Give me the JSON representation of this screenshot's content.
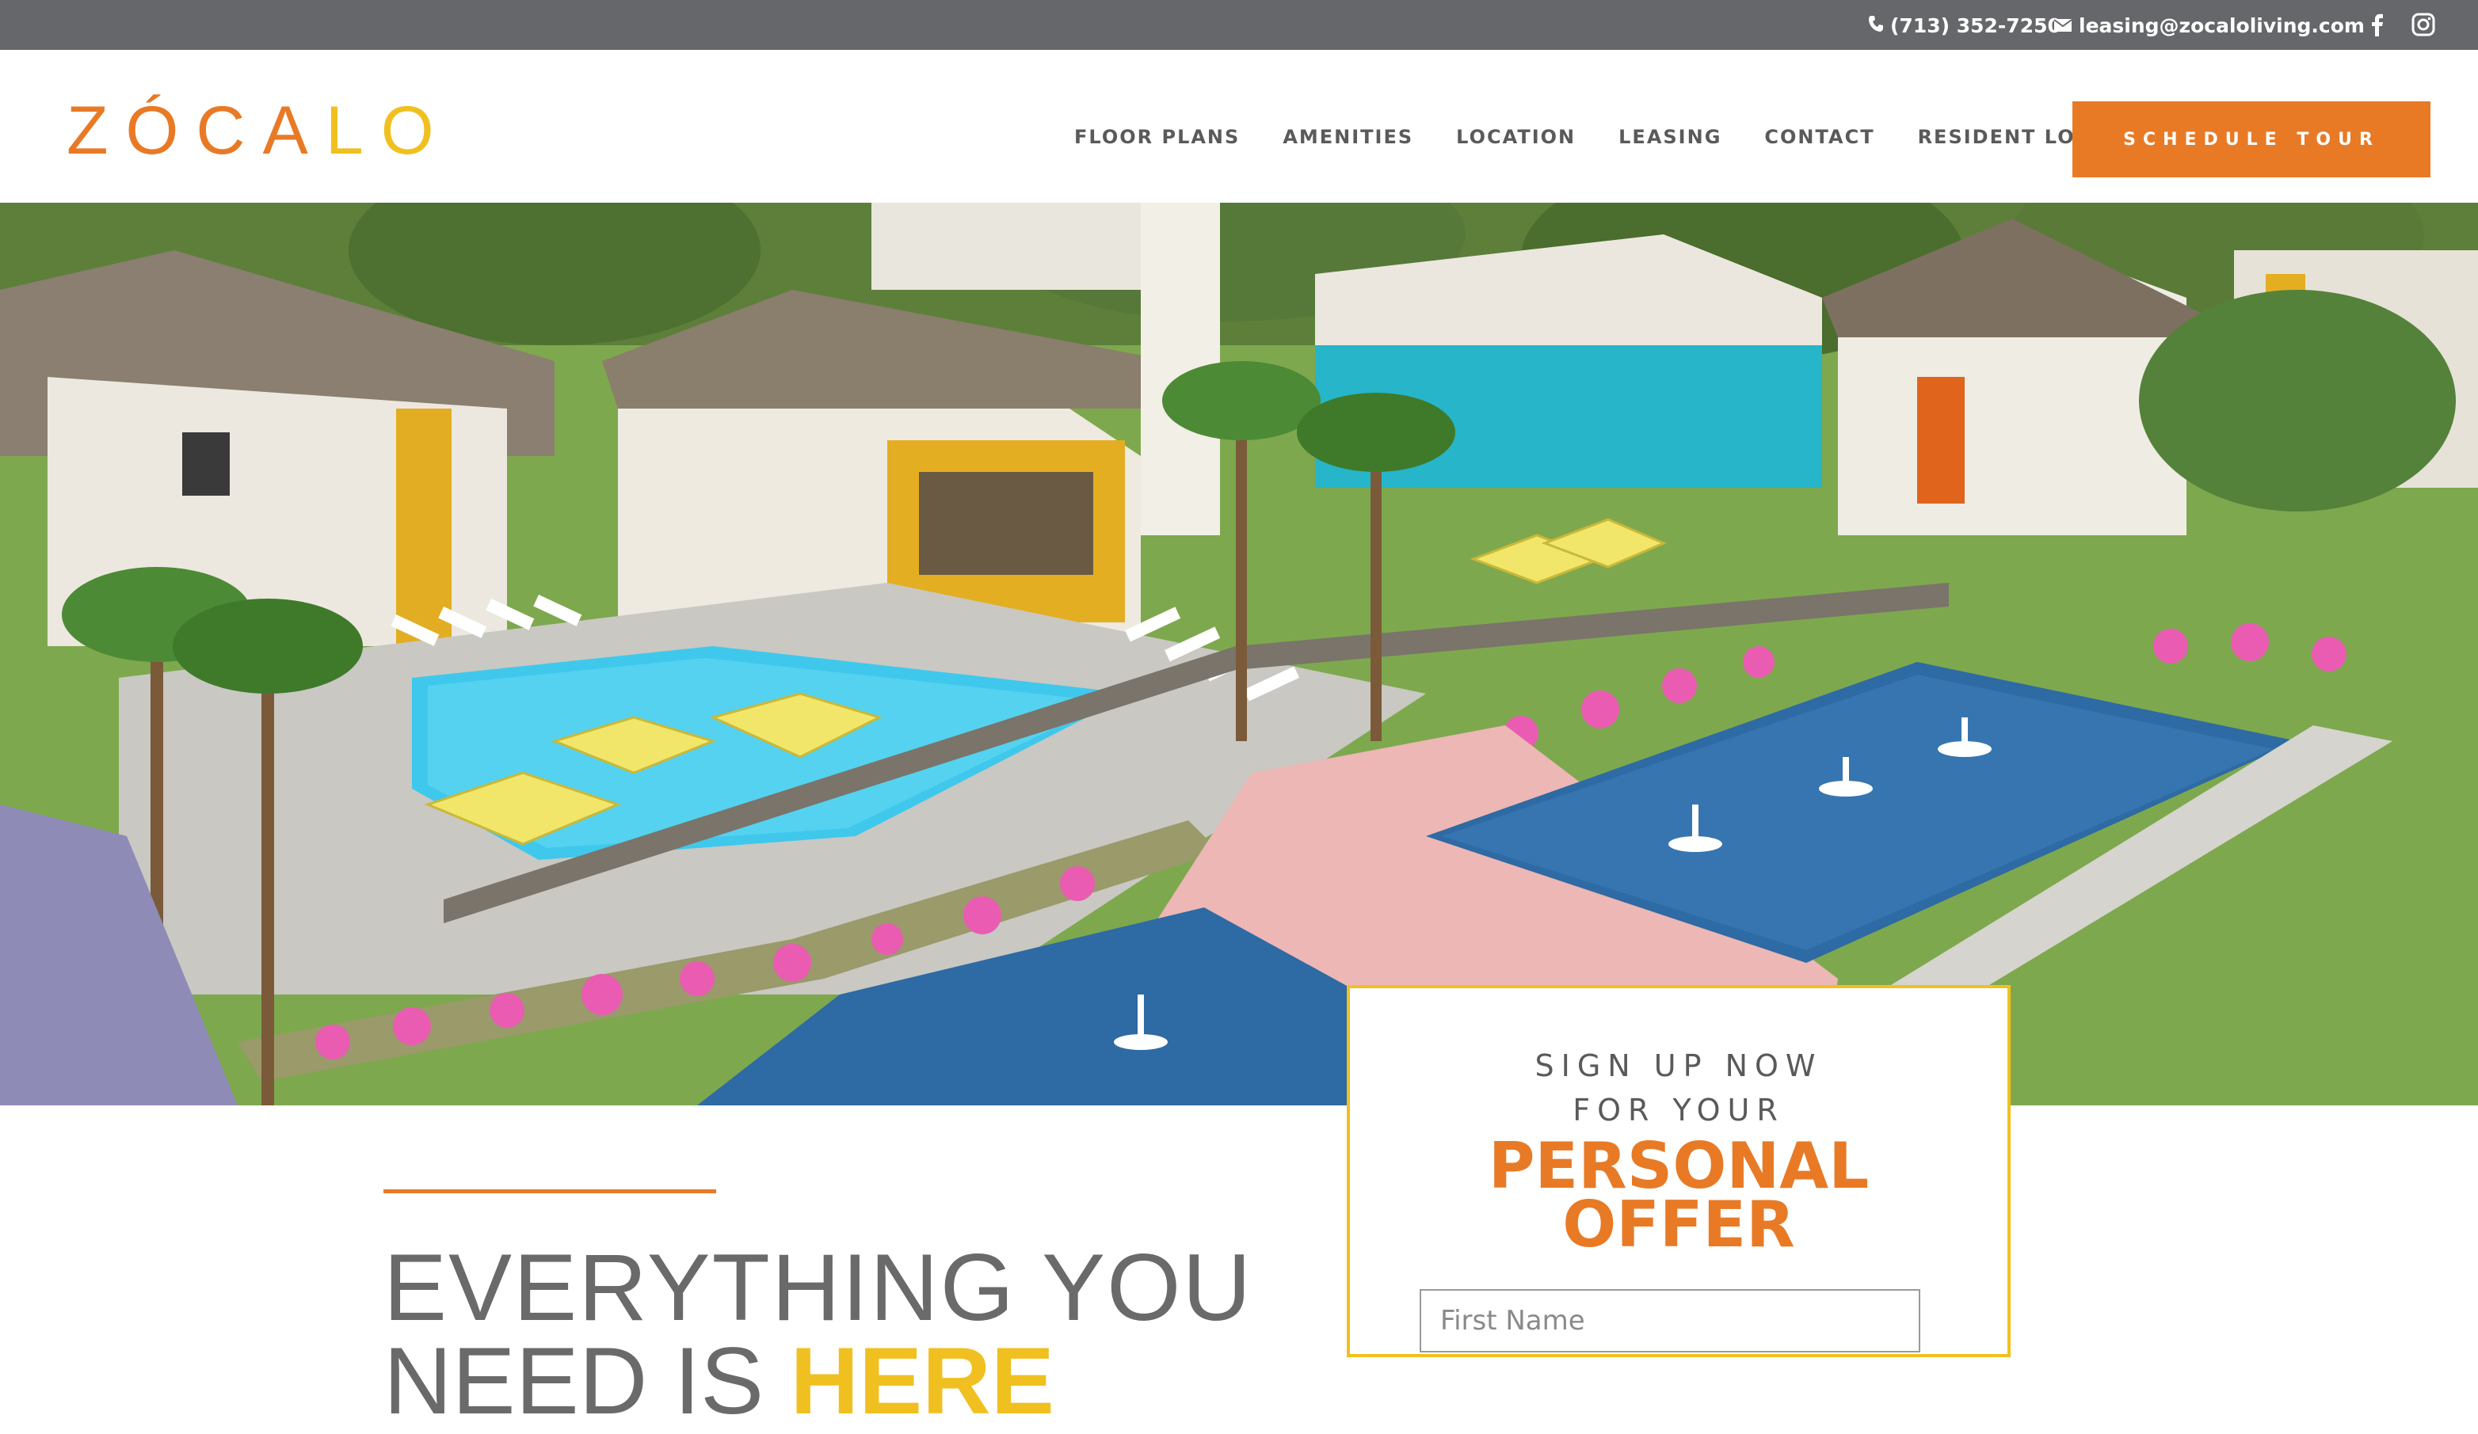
{
  "topbar": {
    "phone": "(713) 352-7250",
    "email": "leasing@zocaloliving.com",
    "icons": [
      "phone-icon",
      "mail-icon",
      "facebook-icon",
      "instagram-icon"
    ]
  },
  "header": {
    "logo": "ZÓCALO",
    "nav": [
      "FLOOR PLANS",
      "AMENITIES",
      "LOCATION",
      "LEASING",
      "CONTACT",
      "RESIDENT LOGIN"
    ],
    "cta": "SCHEDULE TOUR"
  },
  "colors": {
    "accent_orange": "#e87a26",
    "accent_yellow": "#f0c020",
    "topbar_gray": "#66676b",
    "text_gray": "#6a6a6a"
  },
  "hero": {
    "image": "rendered-apartment-courtyard-illustration"
  },
  "main": {
    "headline_line1": "EVERYTHING YOU",
    "headline_line2_prefix": "NEED IS ",
    "headline_line2_highlight": "HERE"
  },
  "signup": {
    "line1": "SIGN UP NOW",
    "line2": "FOR YOUR",
    "offer_line1": "PERSONAL",
    "offer_line2": "OFFER",
    "first_name_placeholder": "First Name"
  }
}
